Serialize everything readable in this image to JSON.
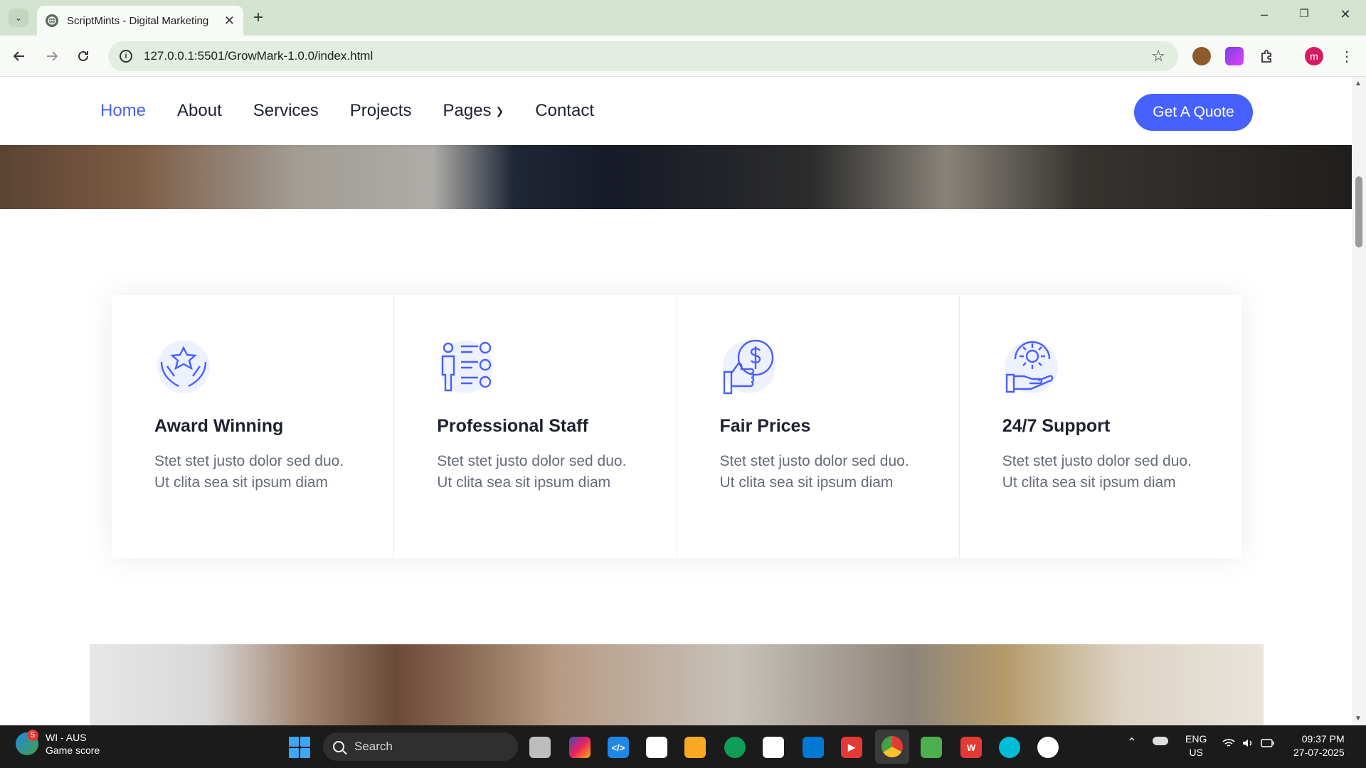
{
  "browser": {
    "tab_title": "ScriptMints - Digital Marketing",
    "url": "127.0.0.1:5501/GrowMark-1.0.0/index.html",
    "profile_initial": "m"
  },
  "nav": {
    "items": [
      {
        "label": "Home",
        "active": true
      },
      {
        "label": "About"
      },
      {
        "label": "Services"
      },
      {
        "label": "Projects"
      },
      {
        "label": "Pages",
        "has_dropdown": true
      },
      {
        "label": "Contact"
      }
    ],
    "cta": "Get A Quote"
  },
  "features": [
    {
      "title": "Award Winning",
      "text": "Stet stet justo dolor sed duo. Ut clita sea sit ipsum diam",
      "icon": "award-hands-star-icon"
    },
    {
      "title": "Professional Staff",
      "text": "Stet stet justo dolor sed duo. Ut clita sea sit ipsum diam",
      "icon": "staff-checklist-icon"
    },
    {
      "title": "Fair Prices",
      "text": "Stet stet justo dolor sed duo. Ut clita sea sit ipsum diam",
      "icon": "thumbs-up-dollar-icon"
    },
    {
      "title": "24/7 Support",
      "text": "Stet stet justo dolor sed duo. Ut clita sea sit ipsum diam",
      "icon": "support-gear-hand-icon"
    }
  ],
  "colors": {
    "accent": "#4761ff",
    "text_dark": "#1e2230",
    "text_muted": "#666b78"
  },
  "taskbar": {
    "widget_badge": "5",
    "widget_title": "WI - AUS",
    "widget_subtitle": "Game score",
    "search_placeholder": "Search",
    "lang_line1": "ENG",
    "lang_line2": "US",
    "time": "09:37 PM",
    "date": "27-07-2025"
  }
}
